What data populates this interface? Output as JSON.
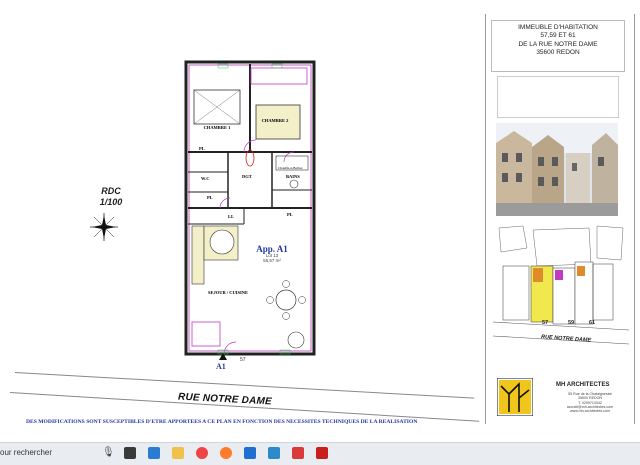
{
  "plan": {
    "level": "RDC",
    "scale": "1/100",
    "rooms": {
      "chambre1": {
        "name": "CHAMBRE 1"
      },
      "chambre2": {
        "name": "CHAMBRE 2"
      },
      "dgt": {
        "name": "DGT"
      },
      "bains": {
        "name": "BAINS"
      },
      "wc": {
        "name": "W.C"
      },
      "sejour": {
        "name": "SEJOUR / CUISINE"
      },
      "ll": "LL",
      "pl1": "PL",
      "pl2": "PL",
      "pl3": "PL",
      "chauffe": "Chauffe-à-Ballon"
    },
    "apartment": {
      "name": "App. A1",
      "lot": "Lot 13",
      "area": "55.57 m²"
    },
    "entrance": "A1",
    "door_number": "57"
  },
  "street": "RUE NOTRE DAME",
  "disclaimer": "DES MODIFICATIONS SONT SUSCEPTIBLES D'ETRE APPORTEES A CE PLAN EN FONCTION DES NECESSITES TECHNIQUES DE LA REALISATION",
  "address": {
    "line1": "IMMEUBLE  D'HABITATION",
    "line2": "57,59 ET 61",
    "line3": "DE LA RUE NOTRE DAME",
    "line4": "35600 REDON"
  },
  "situation": {
    "numbers": [
      "57",
      "59",
      "61"
    ],
    "street": "RUE NOTRE DAME"
  },
  "architect": {
    "name": "MH ARCHITECTES",
    "lines": [
      "55 Rue de la Chataigneraie",
      "35600 REDON",
      "T. 0299713342",
      "accueil@mh-architectes.com",
      "www.mh-architectes.com"
    ]
  },
  "taskbar": {
    "search_placeholder": "our rechercher"
  }
}
